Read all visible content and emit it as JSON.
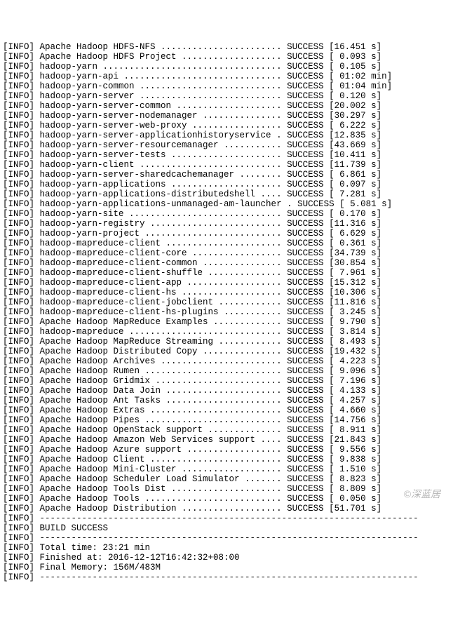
{
  "prefix": "[INFO]",
  "status": "SUCCESS",
  "rows": [
    {
      "name": "Apache Hadoop HDFS-NFS",
      "time": "16.451",
      "unit": "s"
    },
    {
      "name": "Apache Hadoop HDFS Project",
      "time": "0.093",
      "unit": "s"
    },
    {
      "name": "hadoop-yarn",
      "time": "0.105",
      "unit": "s"
    },
    {
      "name": "hadoop-yarn-api",
      "time": "01:02",
      "unit": "min"
    },
    {
      "name": "hadoop-yarn-common",
      "time": "01:04",
      "unit": "min"
    },
    {
      "name": "hadoop-yarn-server",
      "time": "0.120",
      "unit": "s"
    },
    {
      "name": "hadoop-yarn-server-common",
      "time": "20.002",
      "unit": "s"
    },
    {
      "name": "hadoop-yarn-server-nodemanager",
      "time": "30.297",
      "unit": "s"
    },
    {
      "name": "hadoop-yarn-server-web-proxy",
      "time": "6.222",
      "unit": "s"
    },
    {
      "name": "hadoop-yarn-server-applicationhistoryservice",
      "time": "12.835",
      "unit": "s"
    },
    {
      "name": "hadoop-yarn-server-resourcemanager",
      "time": "43.669",
      "unit": "s"
    },
    {
      "name": "hadoop-yarn-server-tests",
      "time": "10.411",
      "unit": "s"
    },
    {
      "name": "hadoop-yarn-client",
      "time": "11.739",
      "unit": "s"
    },
    {
      "name": "hadoop-yarn-server-sharedcachemanager",
      "time": "6.861",
      "unit": "s"
    },
    {
      "name": "hadoop-yarn-applications",
      "time": "0.097",
      "unit": "s"
    },
    {
      "name": "hadoop-yarn-applications-distributedshell",
      "time": "7.281",
      "unit": "s"
    },
    {
      "name": "hadoop-yarn-applications-unmanaged-am-launcher",
      "time": "5.081",
      "unit": "s"
    },
    {
      "name": "hadoop-yarn-site",
      "time": "0.170",
      "unit": "s"
    },
    {
      "name": "hadoop-yarn-registry",
      "time": "11.316",
      "unit": "s"
    },
    {
      "name": "hadoop-yarn-project",
      "time": "6.629",
      "unit": "s"
    },
    {
      "name": "hadoop-mapreduce-client",
      "time": "0.361",
      "unit": "s"
    },
    {
      "name": "hadoop-mapreduce-client-core",
      "time": "34.739",
      "unit": "s"
    },
    {
      "name": "hadoop-mapreduce-client-common",
      "time": "30.854",
      "unit": "s"
    },
    {
      "name": "hadoop-mapreduce-client-shuffle",
      "time": "7.961",
      "unit": "s"
    },
    {
      "name": "hadoop-mapreduce-client-app",
      "time": "15.312",
      "unit": "s"
    },
    {
      "name": "hadoop-mapreduce-client-hs",
      "time": "10.306",
      "unit": "s"
    },
    {
      "name": "hadoop-mapreduce-client-jobclient",
      "time": "11.816",
      "unit": "s"
    },
    {
      "name": "hadoop-mapreduce-client-hs-plugins",
      "time": "3.245",
      "unit": "s"
    },
    {
      "name": "Apache Hadoop MapReduce Examples",
      "time": "9.790",
      "unit": "s"
    },
    {
      "name": "hadoop-mapreduce",
      "time": "3.814",
      "unit": "s"
    },
    {
      "name": "Apache Hadoop MapReduce Streaming",
      "time": "8.493",
      "unit": "s"
    },
    {
      "name": "Apache Hadoop Distributed Copy",
      "time": "19.432",
      "unit": "s"
    },
    {
      "name": "Apache Hadoop Archives",
      "time": "4.223",
      "unit": "s"
    },
    {
      "name": "Apache Hadoop Rumen",
      "time": "9.096",
      "unit": "s"
    },
    {
      "name": "Apache Hadoop Gridmix",
      "time": "7.196",
      "unit": "s"
    },
    {
      "name": "Apache Hadoop Data Join",
      "time": "4.133",
      "unit": "s"
    },
    {
      "name": "Apache Hadoop Ant Tasks",
      "time": "4.257",
      "unit": "s"
    },
    {
      "name": "Apache Hadoop Extras",
      "time": "4.660",
      "unit": "s"
    },
    {
      "name": "Apache Hadoop Pipes",
      "time": "14.756",
      "unit": "s"
    },
    {
      "name": "Apache Hadoop OpenStack support",
      "time": "8.911",
      "unit": "s"
    },
    {
      "name": "Apache Hadoop Amazon Web Services support",
      "time": "21.843",
      "unit": "s"
    },
    {
      "name": "Apache Hadoop Azure support",
      "time": "9.556",
      "unit": "s"
    },
    {
      "name": "Apache Hadoop Client",
      "time": "9.838",
      "unit": "s"
    },
    {
      "name": "Apache Hadoop Mini-Cluster",
      "time": "1.510",
      "unit": "s"
    },
    {
      "name": "Apache Hadoop Scheduler Load Simulator",
      "time": "8.823",
      "unit": "s"
    },
    {
      "name": "Apache Hadoop Tools Dist",
      "time": "8.809",
      "unit": "s"
    },
    {
      "name": "Apache Hadoop Tools",
      "time": "0.050",
      "unit": "s"
    },
    {
      "name": "Apache Hadoop Distribution",
      "time": "51.701",
      "unit": "s"
    }
  ],
  "sep": "------------------------------------------------------------------------",
  "build_success": "BUILD SUCCESS",
  "total_time_label": "Total time:",
  "total_time_value": "23:21 min",
  "finished_label": "Finished at:",
  "finished_value": "2016-12-12T16:42:32+08:00",
  "memory_label": "Final Memory:",
  "memory_value": "156M/483M",
  "watermark": "©深蓝居"
}
